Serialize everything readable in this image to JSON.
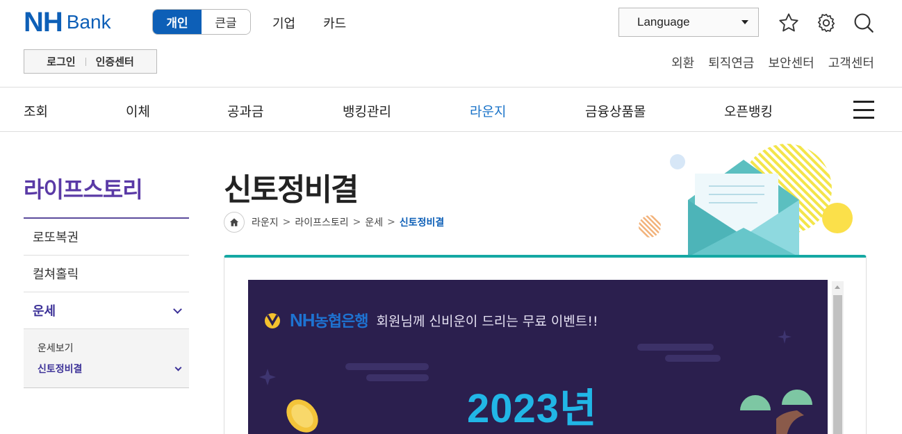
{
  "logo": {
    "nh": "NH",
    "bank": "Bank"
  },
  "segment": {
    "personal": "개인",
    "large_text": "큰글"
  },
  "topnav": {
    "corporate": "기업",
    "card": "카드"
  },
  "language": {
    "label": "Language"
  },
  "auth": {
    "login": "로그인",
    "cert_center": "인증센터"
  },
  "subnav": {
    "fx": "외환",
    "pension": "퇴직연금",
    "security": "보안센터",
    "customer": "고객센터"
  },
  "gnb": {
    "items": [
      "조회",
      "이체",
      "공과금",
      "뱅킹관리",
      "라운지",
      "금융상품몰",
      "오픈뱅킹"
    ],
    "current_index": 4
  },
  "lnb": {
    "title": "라이프스토리",
    "items": [
      "로또복권",
      "컬쳐홀릭",
      "운세"
    ],
    "sub_items": [
      "운세보기",
      "신토정비결"
    ]
  },
  "page": {
    "title": "신토정비결",
    "breadcrumb": [
      "라운지",
      "라이프스토리",
      "운세",
      "신토정비결"
    ]
  },
  "banner": {
    "brand_en": "NH",
    "brand_kr": "농협은행",
    "tagline": "회원님께 신비운이 드리는 무료 이벤트!!",
    "year": "2023년"
  },
  "colors": {
    "brand_blue": "#0d5fb7",
    "lnb_purple": "#5a3aa6",
    "teal": "#15a8a3",
    "banner_bg": "#2b1f4e"
  }
}
